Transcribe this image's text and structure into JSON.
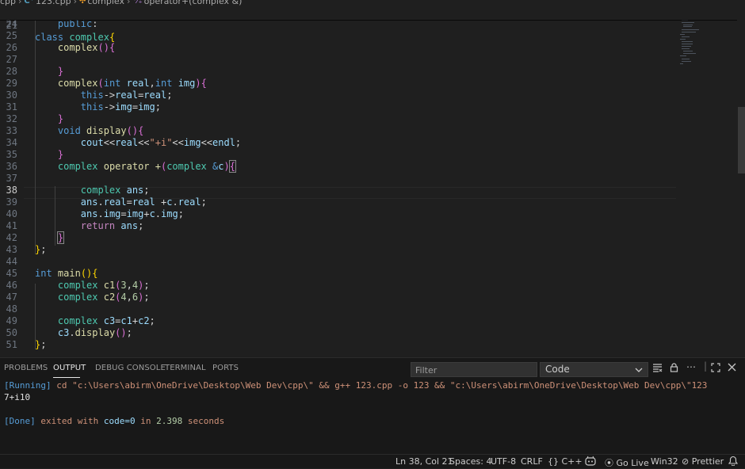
{
  "breadcrumb": {
    "folder": "cpp",
    "file": "123.cpp",
    "file_icon": "cpp-file-icon",
    "class": "complex",
    "class_icon": "class-icon",
    "method": "operator+(complex &)",
    "method_icon": "method-icon"
  },
  "editor": {
    "active_line": 38,
    "sticky": {
      "line": "21",
      "text": "class complex{"
    },
    "lines": [
      {
        "n": "24",
        "text": "    public:"
      },
      {
        "n": "25",
        "text": ""
      },
      {
        "n": "26",
        "text": "    complex(){"
      },
      {
        "n": "27",
        "text": ""
      },
      {
        "n": "28",
        "text": "    }"
      },
      {
        "n": "29",
        "text": "    complex(int real,int img){"
      },
      {
        "n": "30",
        "text": "        this->real=real;"
      },
      {
        "n": "31",
        "text": "        this->img=img;"
      },
      {
        "n": "32",
        "text": "    }"
      },
      {
        "n": "33",
        "text": "    void display(){"
      },
      {
        "n": "34",
        "text": "        cout<<real<<\"+i\"<<img<<endl;"
      },
      {
        "n": "35",
        "text": "    }"
      },
      {
        "n": "36",
        "text": "    complex operator +(complex &c){"
      },
      {
        "n": "37",
        "text": ""
      },
      {
        "n": "38",
        "text": "        complex ans;"
      },
      {
        "n": "39",
        "text": "        ans.real=real +c.real;"
      },
      {
        "n": "40",
        "text": "        ans.img=img+c.img;"
      },
      {
        "n": "41",
        "text": "        return ans;"
      },
      {
        "n": "42",
        "text": "    }"
      },
      {
        "n": "43",
        "text": "};"
      },
      {
        "n": "44",
        "text": ""
      },
      {
        "n": "45",
        "text": "int main(){"
      },
      {
        "n": "46",
        "text": "    complex c1(3,4);"
      },
      {
        "n": "47",
        "text": "    complex c2(4,6);"
      },
      {
        "n": "48",
        "text": ""
      },
      {
        "n": "49",
        "text": "    complex c3=c1+c2;"
      },
      {
        "n": "50",
        "text": "    c3.display();"
      },
      {
        "n": "51",
        "text": "};"
      }
    ]
  },
  "panel": {
    "tabs": [
      "PROBLEMS",
      "OUTPUT",
      "DEBUG CONSOLE",
      "TERMINAL",
      "PORTS"
    ],
    "active_tab": "OUTPUT",
    "filter_placeholder": "Filter",
    "channel": "Code",
    "icons": [
      "clear-output-icon",
      "lock-scroll-icon",
      "more-actions-icon",
      "maximize-panel-icon",
      "close-panel-icon"
    ],
    "output": {
      "running_tag": "[Running]",
      "running_cmd": "cd \"c:\\Users\\abirm\\OneDrive\\Desktop\\Web Dev\\cpp\\\" && g++ 123.cpp -o 123 && \"c:\\Users\\abirm\\OneDrive\\Desktop\\Web Dev\\cpp\\\"123",
      "result": "7+i10",
      "done_tag": "[Done]",
      "done_pre": "exited with",
      "done_code": "code=0",
      "done_in": "in",
      "done_time": "2.398",
      "done_unit": "seconds"
    }
  },
  "statusbar": {
    "cursor": "Ln 38, Col 21",
    "spaces": "Spaces: 4",
    "encoding": "UTF-8",
    "eol": "CRLF",
    "language": "C++",
    "go_live": "Go Live",
    "platform": "Win32",
    "prettier": "Prettier",
    "icons": [
      "braces-icon",
      "copilot-icon",
      "broadcast-icon",
      "prettier-check-icon",
      "notifications-bell-icon"
    ]
  },
  "colors": {
    "background": "#1f1f1f",
    "panel": "#181818",
    "keyword": "#569cd6",
    "type": "#4ec9b0",
    "function": "#dcdcaa",
    "variable": "#9cdcfe",
    "string": "#ce9178",
    "number": "#b5cea8"
  }
}
